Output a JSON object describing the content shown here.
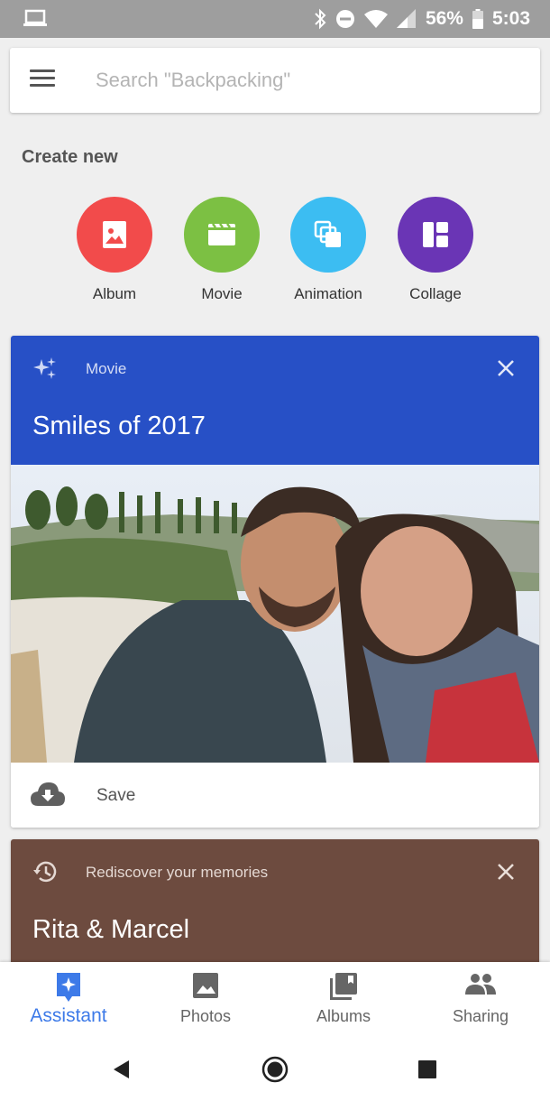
{
  "status_bar": {
    "battery": "56%",
    "time": "5:03"
  },
  "search": {
    "placeholder": "Search \"Backpacking\""
  },
  "create_new": {
    "title": "Create new",
    "items": [
      {
        "label": "Album",
        "color": "#f24b4b",
        "icon": "photo-icon"
      },
      {
        "label": "Movie",
        "color": "#7cc043",
        "icon": "clapper-icon"
      },
      {
        "label": "Animation",
        "color": "#3cbdf2",
        "icon": "animation-icon"
      },
      {
        "label": "Collage",
        "color": "#6a35b5",
        "icon": "collage-icon"
      }
    ]
  },
  "movie_card": {
    "kind": "Movie",
    "title": "Smiles of 2017",
    "save_label": "Save",
    "header_color": "#2750c6"
  },
  "memories_card": {
    "kind": "Rediscover your memories",
    "title": "Rita & Marcel",
    "header_color": "#6d4b3f"
  },
  "bottom_nav": {
    "items": [
      {
        "label": "Assistant",
        "active": true
      },
      {
        "label": "Photos",
        "active": false
      },
      {
        "label": "Albums",
        "active": false
      },
      {
        "label": "Sharing",
        "active": false
      }
    ],
    "accent": "#3d7ae8"
  }
}
